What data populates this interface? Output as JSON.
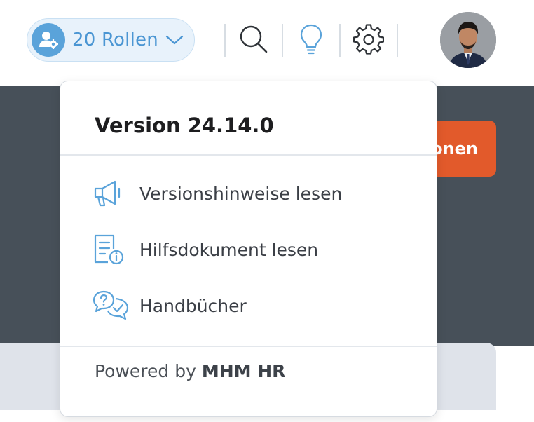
{
  "header": {
    "roles_label": "20 Rollen",
    "icons": [
      "user-gear-icon",
      "chevron-down-icon",
      "search-icon",
      "lightbulb-icon",
      "gear-icon"
    ]
  },
  "background": {
    "action_button_label": "onen"
  },
  "help_menu": {
    "version_title": "Version 24.14.0",
    "items": [
      {
        "label": "Versionshinweise lesen",
        "icon": "megaphone-icon"
      },
      {
        "label": "Hilfsdokument lesen",
        "icon": "document-info-icon"
      },
      {
        "label": "Handbücher",
        "icon": "chat-question-icon"
      }
    ],
    "powered_prefix": "Powered by",
    "powered_brand": "MHM HR"
  },
  "colors": {
    "accent": "#4b96d3",
    "pill_bg": "#e8f2fb",
    "dark_band": "#475059",
    "orange": "#e25a2b"
  }
}
